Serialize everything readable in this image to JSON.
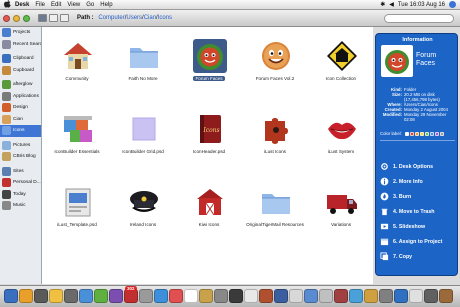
{
  "menubar": {
    "app_name": "Desk",
    "items": [
      "File",
      "Edit",
      "View",
      "Go",
      "Help"
    ],
    "clock": "Tue 16:03 Aug 16"
  },
  "toolbar": {
    "path_label": "Path :",
    "path_segments": [
      "Computer",
      "Users",
      "Cian",
      "Icons"
    ],
    "path_separator": "/"
  },
  "sidebar": {
    "items": [
      {
        "label": "Projects",
        "color": "#4a7fd0",
        "selected": false
      },
      {
        "label": "Recent Searches",
        "color": "#8a8aa0",
        "selected": false
      },
      {
        "label": "Clipboard",
        "color": "#3a6fbf",
        "selected": false
      },
      {
        "label": "Cupboard",
        "color": "#c58a3c",
        "selected": false
      },
      {
        "label": "afterglow",
        "color": "#5a9a3c",
        "selected": false
      },
      {
        "label": "Applications",
        "color": "#7a7a7a",
        "selected": false
      },
      {
        "label": "Design",
        "color": "#d25c2a",
        "selected": false
      },
      {
        "label": "Cian",
        "color": "#d8a05a",
        "selected": false
      },
      {
        "label": "Icons",
        "color": "#6fa0e6",
        "selected": true
      },
      {
        "label": "Pictures",
        "color": "#8ab0dc",
        "selected": false
      },
      {
        "label": "CBris Blog",
        "color": "#c2a15c",
        "selected": false
      },
      {
        "label": "Sites",
        "color": "#5b7fae",
        "selected": false
      },
      {
        "label": "Personal D...",
        "color": "#c33030",
        "selected": false
      },
      {
        "label": "Today",
        "color": "#444",
        "selected": false
      },
      {
        "label": "Music",
        "color": "#888",
        "selected": false
      }
    ]
  },
  "files": [
    {
      "label": "Community",
      "icon": "house-icon",
      "selected": false
    },
    {
      "label": "Faith No More",
      "icon": "folder-icon",
      "selected": false
    },
    {
      "label": "Forum Faces",
      "icon": "forum-face-icon",
      "selected": true
    },
    {
      "label": "Forum Faces Vol.2",
      "icon": "smiley-face-icon",
      "selected": false
    },
    {
      "label": "Icon Collection",
      "icon": "road-sign-icon",
      "selected": false
    },
    {
      "label": "IconBuilder Essentials",
      "icon": "cubes-icon",
      "selected": false
    },
    {
      "label": "IconBuilder Grid.psd",
      "icon": "grid-image-icon",
      "selected": false
    },
    {
      "label": "IconHeader.psd",
      "icon": "book-icon",
      "selected": false
    },
    {
      "label": "iLust Icons",
      "icon": "puzzle-piece-icon",
      "selected": false
    },
    {
      "label": "iLust System",
      "icon": "lips-icon",
      "selected": false
    },
    {
      "label": "iLust_Template.psd",
      "icon": "document-template-icon",
      "selected": false
    },
    {
      "label": "Ireland Icons",
      "icon": "police-hat-icon",
      "selected": false
    },
    {
      "label": "Kiwi Icons",
      "icon": "barn-icon",
      "selected": false
    },
    {
      "label": "OriginalTigerMail Resources",
      "icon": "folder-icon",
      "selected": false
    },
    {
      "label": "Variations",
      "icon": "truck-icon",
      "selected": false
    }
  ],
  "info": {
    "title": "Information",
    "name": "Forum Faces",
    "fields": [
      {
        "key": "Kind:",
        "value": "Folder"
      },
      {
        "key": "Size:",
        "value": "20.2 MB on disk (17,456,798 bytes)"
      },
      {
        "key": "Where:",
        "value": "/Users/Cian/Icons"
      },
      {
        "key": "Created:",
        "value": "Monday 2 August 2004"
      },
      {
        "key": "Modified:",
        "value": "Monday 29 November 02:08"
      }
    ],
    "color_label": "Color label:",
    "color_dots": [
      "#ffffff",
      "#e0443a",
      "#f29a2e",
      "#f2d43a",
      "#7cc34a",
      "#4a8fe0",
      "#a05ad6",
      "#9a9a9a"
    ],
    "actions": [
      {
        "label": "1. Desk Options",
        "icon": "gear-icon"
      },
      {
        "label": "2. More Info",
        "icon": "info-icon"
      },
      {
        "label": "3. Burn",
        "icon": "burn-icon"
      },
      {
        "label": "4. Move to Trash",
        "icon": "trash-icon"
      },
      {
        "label": "5. Slideshow",
        "icon": "slideshow-icon"
      },
      {
        "label": "6. Assign to Project",
        "icon": "project-icon"
      },
      {
        "label": "7. Copy",
        "icon": "copy-icon"
      }
    ]
  },
  "dock": {
    "badge": "302",
    "icons": [
      "#3a6fbf",
      "#e8a02a",
      "#5a5a5a",
      "#f0c040",
      "#6a6a6a",
      "#4a90d9",
      "#60b040",
      "#7b4fb0",
      "#c03030",
      "#9a9a9a",
      "#3c8fd8",
      "#e05050",
      "#ffffff",
      "#c8a24a",
      "#888",
      "#3a3a3a",
      "#e8e8e8",
      "#b05030",
      "#3b5ea0",
      "#d8d8d8",
      "#5a8ad0",
      "#c0c0c0",
      "#a04040",
      "#4aa0d8",
      "#d0a040",
      "#808080",
      "#3070c0",
      "#e0e0e0",
      "#606060",
      "#9a6a3a"
    ]
  }
}
